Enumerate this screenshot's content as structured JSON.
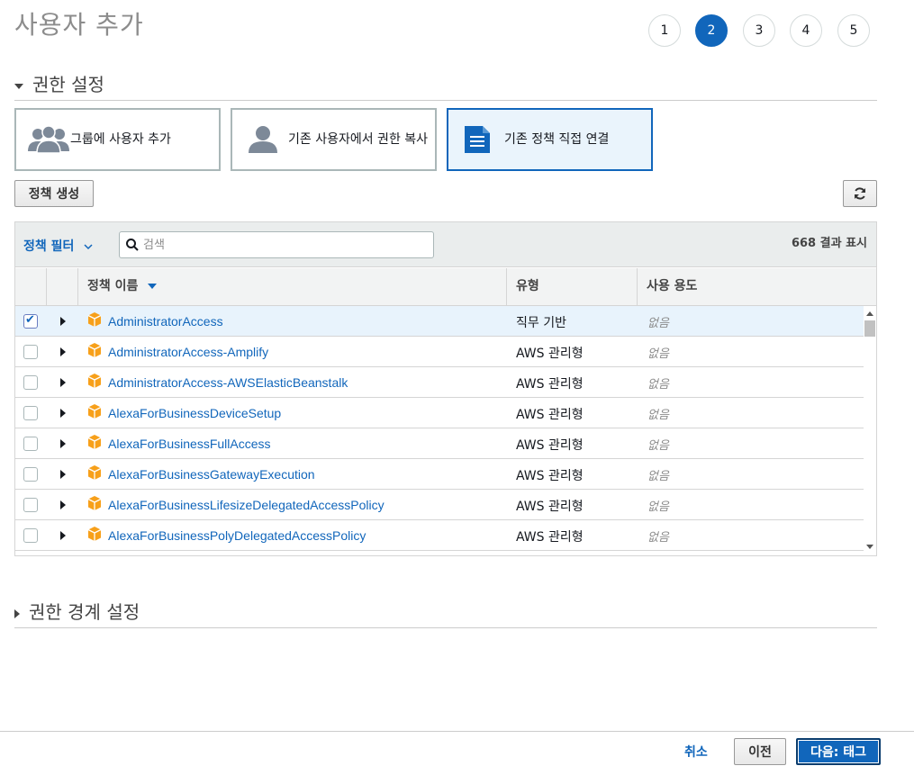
{
  "page": {
    "title": "사용자 추가"
  },
  "steps": [
    {
      "label": "1",
      "active": false
    },
    {
      "label": "2",
      "active": true
    },
    {
      "label": "3",
      "active": false
    },
    {
      "label": "4",
      "active": false
    },
    {
      "label": "5",
      "active": false
    }
  ],
  "permissions": {
    "section_title": "권한 설정",
    "options": [
      {
        "label": "그룹에 사용자 추가",
        "icon": "users-group-icon",
        "selected": false
      },
      {
        "label": "기존 사용자에서 권한 복사",
        "icon": "user-icon",
        "selected": false
      },
      {
        "label": "기존 정책 직접 연결",
        "icon": "document-icon",
        "selected": true
      }
    ],
    "create_policy_label": "정책 생성",
    "refresh_icon": "refresh-icon"
  },
  "table": {
    "filter_label": "정책 필터",
    "search_placeholder": "검색",
    "results_count": "668 결과 표시",
    "columns": {
      "name": "정책 이름",
      "type": "유형",
      "usage": "사용 용도"
    },
    "rows": [
      {
        "name": "AdministratorAccess",
        "type": "직무 기반",
        "usage": "없음",
        "checked": true
      },
      {
        "name": "AdministratorAccess-Amplify",
        "type": "AWS 관리형",
        "usage": "없음",
        "checked": false
      },
      {
        "name": "AdministratorAccess-AWSElasticBeanstalk",
        "type": "AWS 관리형",
        "usage": "없음",
        "checked": false
      },
      {
        "name": "AlexaForBusinessDeviceSetup",
        "type": "AWS 관리형",
        "usage": "없음",
        "checked": false
      },
      {
        "name": "AlexaForBusinessFullAccess",
        "type": "AWS 관리형",
        "usage": "없음",
        "checked": false
      },
      {
        "name": "AlexaForBusinessGatewayExecution",
        "type": "AWS 관리형",
        "usage": "없음",
        "checked": false
      },
      {
        "name": "AlexaForBusinessLifesizeDelegatedAccessPolicy",
        "type": "AWS 관리형",
        "usage": "없음",
        "checked": false
      },
      {
        "name": "AlexaForBusinessPolyDelegatedAccessPolicy",
        "type": "AWS 관리형",
        "usage": "없음",
        "checked": false
      }
    ]
  },
  "boundary": {
    "section_title": "권한 경계 설정"
  },
  "footer": {
    "cancel_label": "취소",
    "prev_label": "이전",
    "next_label": "다음: 태그"
  },
  "colors": {
    "accent": "#1166bb",
    "selected_row": "#e8f3fc",
    "policy_icon": "#f7a01a"
  }
}
